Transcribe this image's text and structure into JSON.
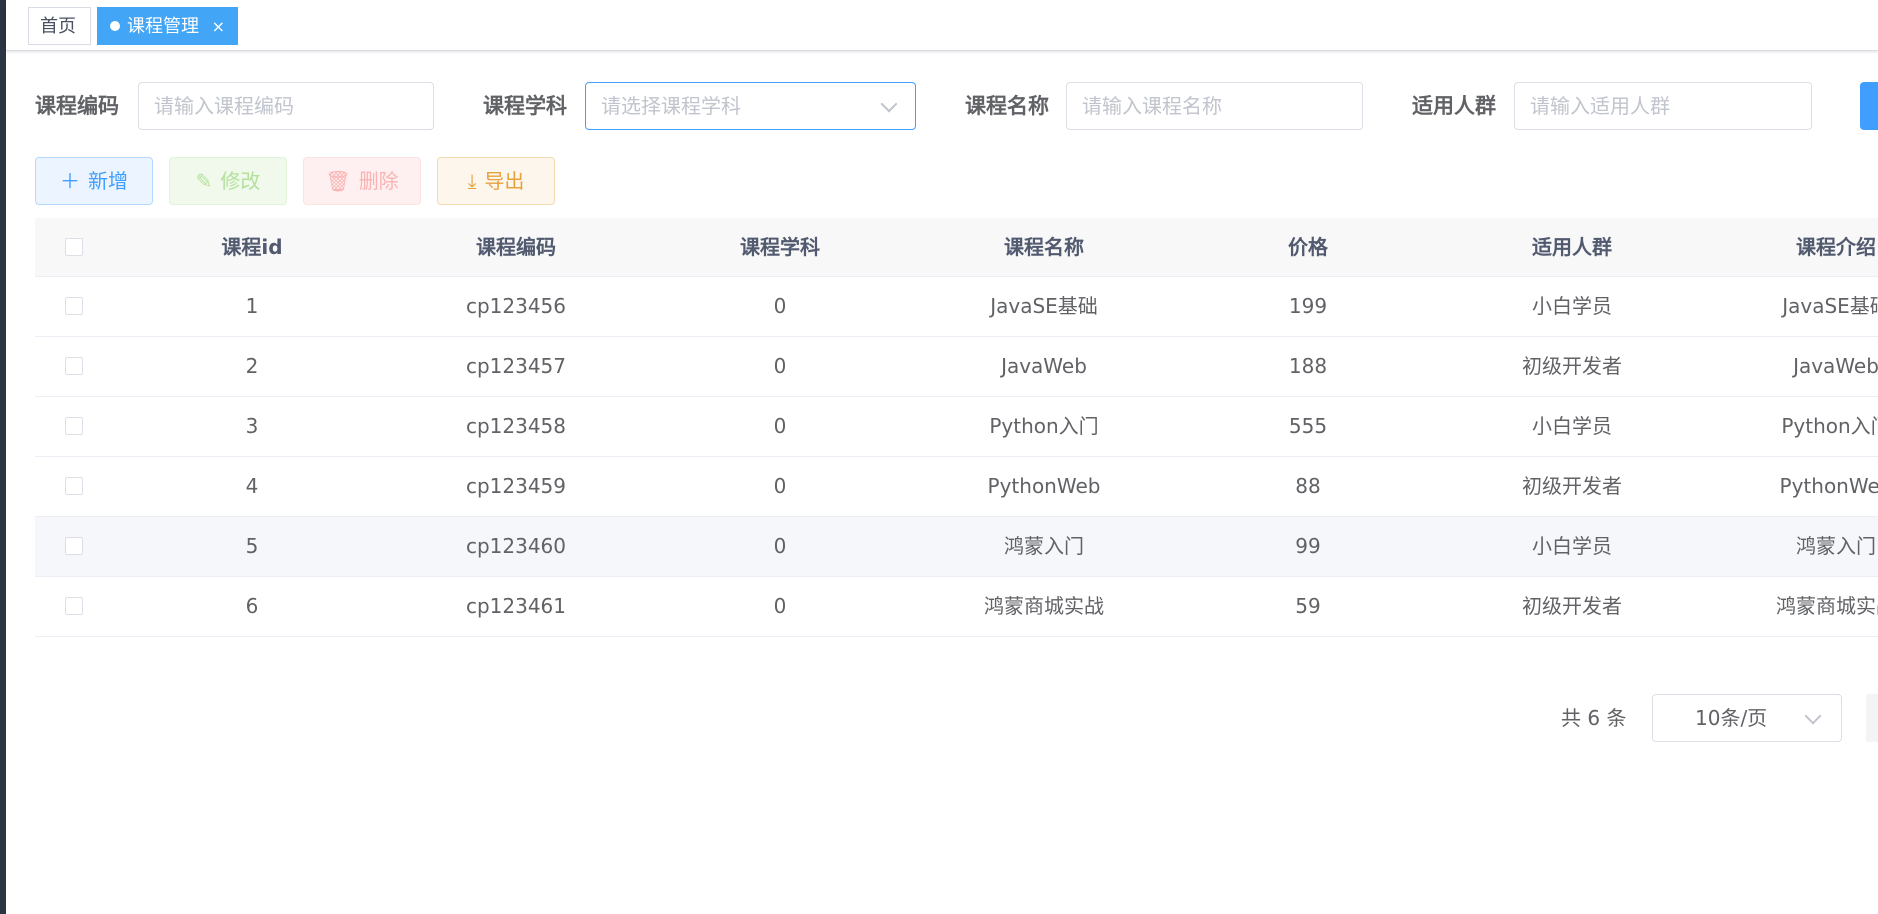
{
  "tags": {
    "home": "首页",
    "active": "课程管理",
    "close_glyph": "×"
  },
  "search": {
    "code_label": "课程编码",
    "code_placeholder": "请输入课程编码",
    "subject_label": "课程学科",
    "subject_placeholder": "请选择课程学科",
    "name_label": "课程名称",
    "name_placeholder": "请输入课程名称",
    "crowd_label": "适用人群",
    "crowd_placeholder": "请输入适用人群"
  },
  "toolbar": {
    "add_icon": "＋",
    "add_label": "新增",
    "edit_icon": "✎",
    "edit_label": "修改",
    "delete_icon": "🗑",
    "delete_label": "删除",
    "export_icon": "⤓",
    "export_label": "导出",
    "colors": {
      "primary": "#409eff",
      "success": "#67c23a",
      "danger": "#f56c6c",
      "warning": "#e6a23c"
    }
  },
  "table": {
    "columns": [
      "课程id",
      "课程编码",
      "课程学科",
      "课程名称",
      "价格",
      "适用人群",
      "课程介绍"
    ],
    "rows": [
      [
        "1",
        "cp123456",
        "0",
        "JavaSE基础",
        "199",
        "小白学员",
        "JavaSE基础"
      ],
      [
        "2",
        "cp123457",
        "0",
        "JavaWeb",
        "188",
        "初级开发者",
        "JavaWeb"
      ],
      [
        "3",
        "cp123458",
        "0",
        "Python入门",
        "555",
        "小白学员",
        "Python入门"
      ],
      [
        "4",
        "cp123459",
        "0",
        "PythonWeb",
        "88",
        "初级开发者",
        "PythonWeb"
      ],
      [
        "5",
        "cp123460",
        "0",
        "鸿蒙入门",
        "99",
        "小白学员",
        "鸿蒙入门"
      ],
      [
        "6",
        "cp123461",
        "0",
        "鸿蒙商城实战",
        "59",
        "初级开发者",
        "鸿蒙商城实战"
      ]
    ]
  },
  "pagination": {
    "total": "共 6 条",
    "page_size": "10条/页"
  }
}
